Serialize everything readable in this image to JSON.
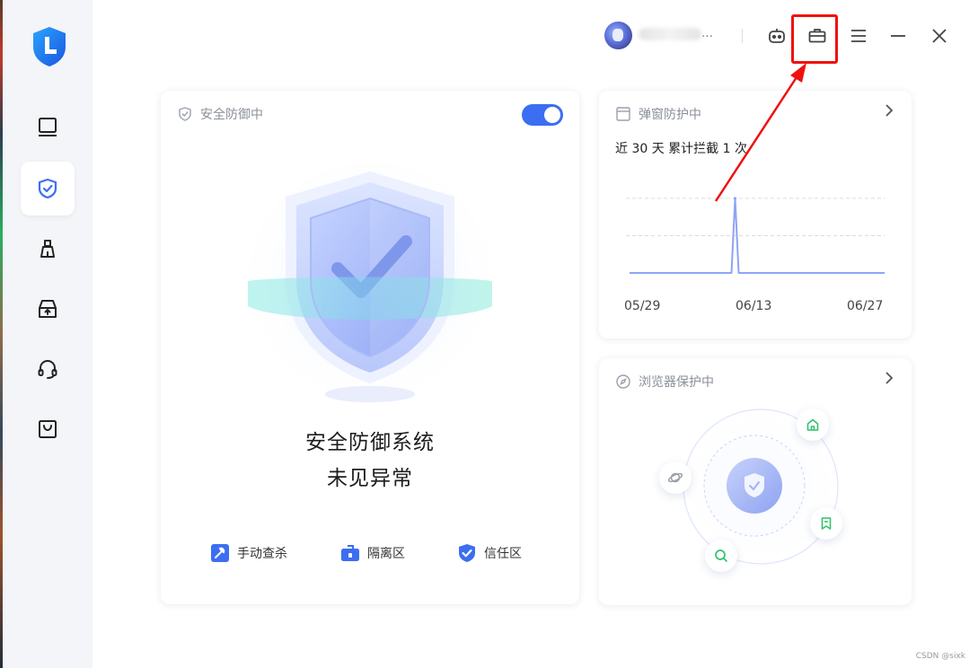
{
  "topbar": {
    "username": "…"
  },
  "main_card": {
    "header": "安全防御中",
    "status_line1": "安全防御系统",
    "status_line2": "未见异常",
    "actions": [
      {
        "label": "手动查杀"
      },
      {
        "label": "隔离区"
      },
      {
        "label": "信任区"
      }
    ]
  },
  "popup_card": {
    "header": "弹窗防护中",
    "summary": "近 30 天 累计拦截 1 次"
  },
  "browser_card": {
    "header": "浏览器保护中"
  },
  "chart_data": {
    "type": "line",
    "categories": [
      "05/29",
      "06/13",
      "06/27"
    ],
    "x": [
      "05/29",
      "05/30",
      "05/31",
      "06/01",
      "06/02",
      "06/03",
      "06/04",
      "06/05",
      "06/06",
      "06/07",
      "06/08",
      "06/09",
      "06/10",
      "06/11",
      "06/12",
      "06/13",
      "06/14",
      "06/15",
      "06/16",
      "06/17",
      "06/18",
      "06/19",
      "06/20",
      "06/21",
      "06/22",
      "06/23",
      "06/24",
      "06/25",
      "06/26",
      "06/27"
    ],
    "series": [
      {
        "values": [
          0,
          0,
          0,
          0,
          0,
          0,
          0,
          0,
          0,
          0,
          0,
          0,
          1,
          0,
          0,
          0,
          0,
          0,
          0,
          0,
          0,
          0,
          0,
          0,
          0,
          0,
          0,
          0,
          0,
          0
        ]
      }
    ],
    "ylim": [
      0,
      1.3
    ],
    "grid": true,
    "color": "#8ea4f5"
  },
  "colors": {
    "accent": "#3c6ef2",
    "highlight": "#f01010"
  },
  "watermark": "CSDN @sixk"
}
